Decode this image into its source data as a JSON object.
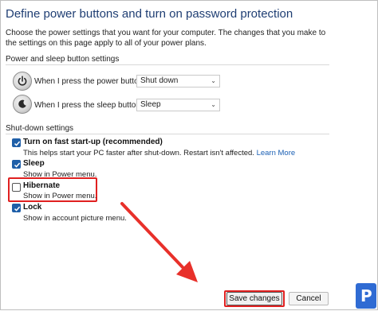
{
  "page": {
    "title": "Define power buttons and turn on password protection",
    "description": "Choose the power settings that you want for your computer. The changes that you make to the settings on this page apply to all of your power plans."
  },
  "power_sleep": {
    "section_label": "Power and sleep button settings",
    "power_button": {
      "label": "When I press the power button:",
      "value": "Shut down"
    },
    "sleep_button": {
      "label": "When I press the sleep button:",
      "value": "Sleep"
    }
  },
  "shutdown": {
    "section_label": "Shut-down settings",
    "options": [
      {
        "title": "Turn on fast start-up (recommended)",
        "subtitle": "This helps start your PC faster after shut-down. Restart isn't affected.",
        "link": "Learn More",
        "checked": true
      },
      {
        "title": "Sleep",
        "subtitle": "Show in Power menu.",
        "checked": true
      },
      {
        "title": "Hibernate",
        "subtitle": "Show in Power menu.",
        "checked": false
      },
      {
        "title": "Lock",
        "subtitle": "Show in account picture menu.",
        "checked": true
      }
    ]
  },
  "footer": {
    "save_label": "Save changes",
    "cancel_label": "Cancel"
  },
  "colors": {
    "title": "#1f3e73",
    "accent": "#1f5fa8",
    "highlight": "#e02020",
    "logo": "#2f6bd3"
  },
  "icons": {
    "power_button": "power-icon",
    "sleep_button": "sleep-icon",
    "logo": "brand-logo-icon"
  }
}
